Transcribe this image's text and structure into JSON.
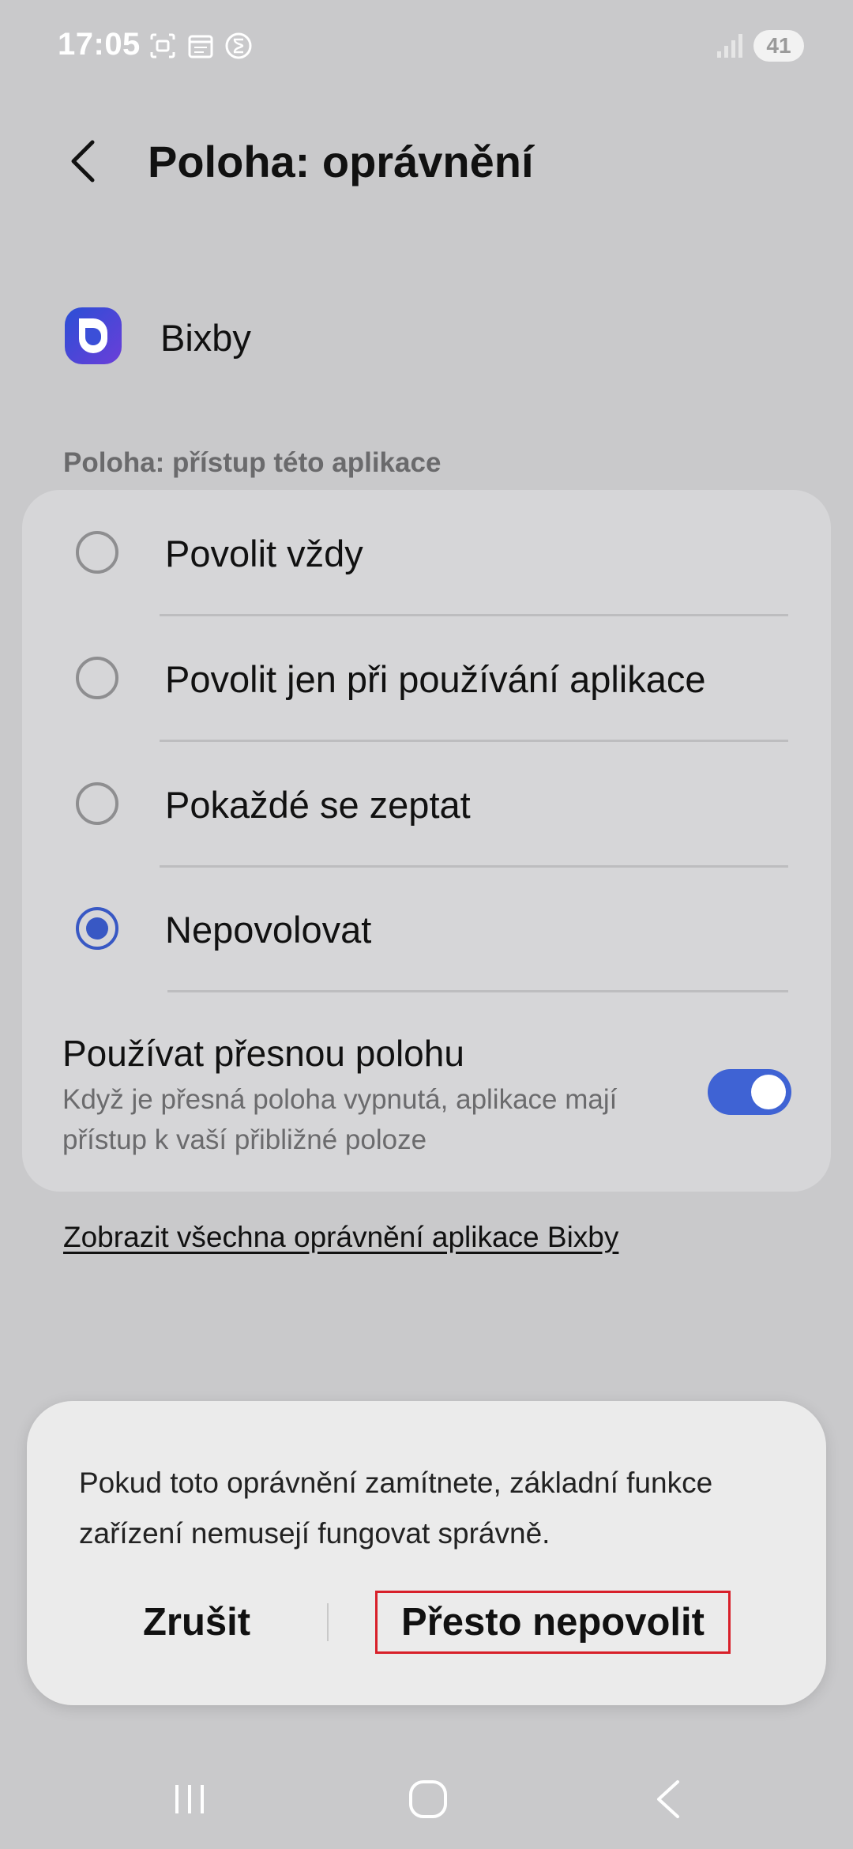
{
  "status_bar": {
    "time": "17:05",
    "battery": "41",
    "icons_left": [
      "screenshot-icon",
      "calendar-icon",
      "bixby-routine-icon"
    ],
    "icons_right": [
      "signal-icon",
      "battery-icon"
    ]
  },
  "header": {
    "title": "Poloha: oprávnění",
    "back_icon": "back-arrow-icon"
  },
  "app": {
    "name": "Bixby",
    "icon": "bixby-app-icon"
  },
  "section_label": "Poloha: přístup této aplikace",
  "options": [
    {
      "label": "Povolit vždy",
      "selected": false
    },
    {
      "label": "Povolit jen při používání aplikace",
      "selected": false
    },
    {
      "label": "Pokaždé se zeptat",
      "selected": false
    },
    {
      "label": "Nepovolovat",
      "selected": true
    }
  ],
  "precise": {
    "title": "Používat přesnou polohu",
    "description": "Když je přesná poloha vypnutá, aplikace mají přístup k vaší přibližné poloze",
    "enabled": true
  },
  "link": "Zobrazit všechna oprávnění aplikace Bixby",
  "dialog": {
    "message": "Pokud toto oprávnění zamítnete, základní funkce zařízení nemusejí fungovat správně.",
    "cancel_label": "Zrušit",
    "confirm_label": "Přesto nepovolit"
  },
  "colors": {
    "accent": "#3f63d4",
    "highlight_border": "#d8202a",
    "background": "#c9c9cb"
  },
  "nav_bar": [
    "recents-icon",
    "home-icon",
    "back-icon"
  ]
}
